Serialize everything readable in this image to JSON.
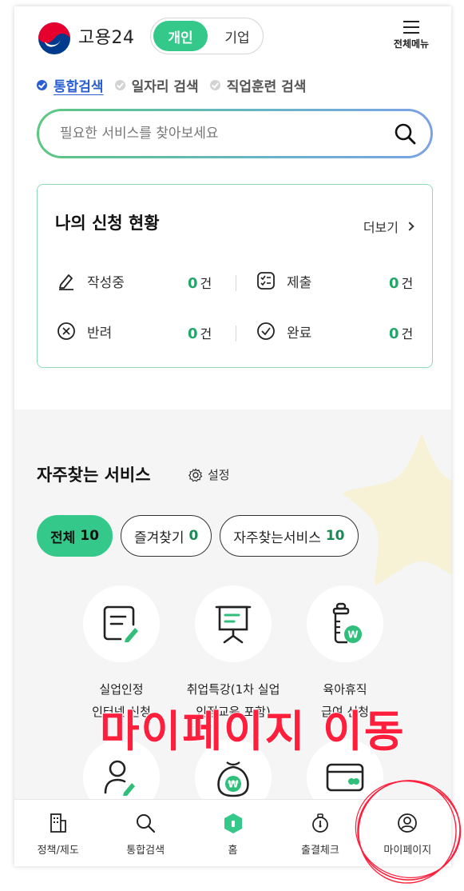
{
  "header": {
    "brand": "고용24",
    "segment_active": "개인",
    "segment_inactive": "기업",
    "menu_label": "전체메뉴"
  },
  "search_tabs": [
    {
      "label": "통합검색",
      "active": true
    },
    {
      "label": "일자리 검색",
      "active": false
    },
    {
      "label": "직업훈련 검색",
      "active": false
    }
  ],
  "search": {
    "placeholder": "필요한 서비스를 찾아보세요",
    "value": ""
  },
  "status_card": {
    "title": "나의 신청 현황",
    "more_label": "더보기",
    "items": [
      {
        "label": "작성중",
        "count": "0",
        "unit": "건",
        "icon": "pencil-icon"
      },
      {
        "label": "제출",
        "count": "0",
        "unit": "건",
        "icon": "checklist-icon"
      },
      {
        "label": "반려",
        "count": "0",
        "unit": "건",
        "icon": "x-circle-icon"
      },
      {
        "label": "완료",
        "count": "0",
        "unit": "건",
        "icon": "check-circle-icon"
      }
    ]
  },
  "frequent": {
    "title": "자주찾는 서비스",
    "settings_label": "설정",
    "chips": [
      {
        "label": "전체",
        "count": "10",
        "active": true
      },
      {
        "label": "즐겨찾기",
        "count": "0",
        "active": false
      },
      {
        "label": "자주찾는서비스",
        "count": "10",
        "active": false
      }
    ],
    "services": [
      {
        "line1": "실업인정",
        "line2": "인터넷 신청",
        "icon": "document-pen-icon"
      },
      {
        "line1": "취업특강(1차 실업",
        "line2": "인정교육 포함)",
        "icon": "presentation-board-icon"
      },
      {
        "line1": "육아휴직",
        "line2": "급여 신청",
        "icon": "baby-bottle-icon"
      }
    ],
    "services_row2_icons": [
      "person-edit-icon",
      "money-bag-icon",
      "card-icon"
    ]
  },
  "overlay_annotation": "마이페이지 이동",
  "bottom_nav": [
    {
      "label": "정책/제도",
      "icon": "building-icon"
    },
    {
      "label": "통합검색",
      "icon": "search-icon"
    },
    {
      "label": "홈",
      "icon": "home-icon"
    },
    {
      "label": "출결체크",
      "icon": "attendance-icon"
    },
    {
      "label": "마이페이지",
      "icon": "user-circle-icon"
    }
  ],
  "colors": {
    "accent_green": "#34c98a",
    "count_green": "#1fa86a",
    "active_tab_blue": "#2a5fd1",
    "annotation_red": "#ff1e3c"
  }
}
